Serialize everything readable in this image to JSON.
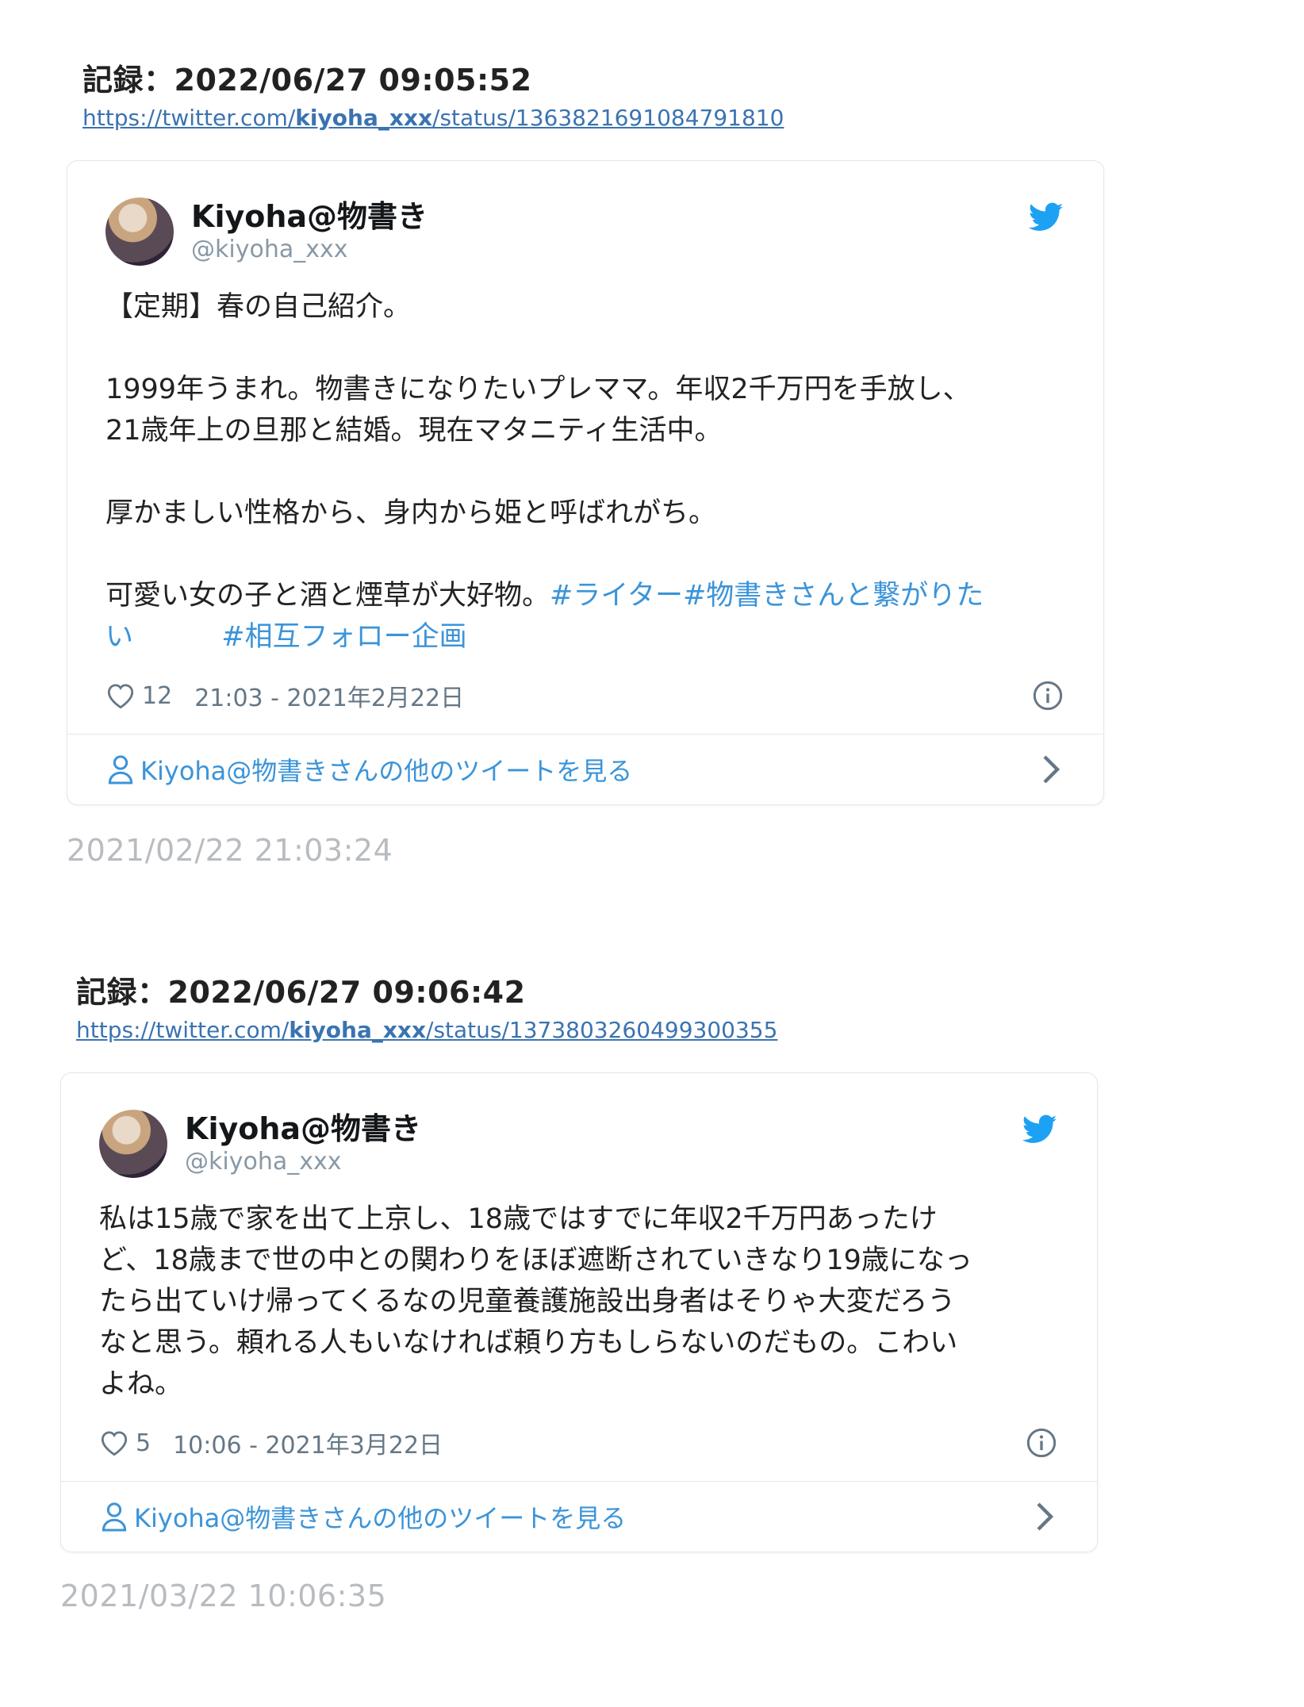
{
  "records": [
    {
      "title": "記録：2022/06/27 09:05:52",
      "url_pre": "https://twitter.com/",
      "url_bold": "kiyoha_xxx",
      "url_post": "/status/1363821691084791810",
      "tweet": {
        "name": "Kiyoha@物書き",
        "handle": "@kiyoha_xxx",
        "line1": "【定期】春の自己紹介。",
        "line2": "1999年うまれ。物書きになりたいプレママ。年収2千万円を手放し、\n21歳年上の旦那と結婚。現在マタニティ生活中。",
        "line3": "厚かましい性格から、身内から姫と呼ばれがち。",
        "line4_text": "可愛い女の子と酒と煙草が大好物。",
        "tag1": "#ライター",
        "tag2": "#物書きさんと繋がりた\nい",
        "tag3": "#相互フォロー企画",
        "likes": "12",
        "time": "21:03 - 2021年2月22日",
        "more": "Kiyoha@物書きさんの他のツイートを見る"
      },
      "stamp": "2021/02/22 21:03:24"
    },
    {
      "title": "記録：2022/06/27 09:06:42",
      "url_pre": "https://twitter.com/",
      "url_bold": "kiyoha_xxx",
      "url_post": "/status/1373803260499300355",
      "tweet": {
        "name": "Kiyoha@物書き",
        "handle": "@kiyoha_xxx",
        "text": "私は15歳で家を出て上京し、18歳ではすでに年収2千万円あったけ\nど、18歳まで世の中との関わりをほぼ遮断されていきなり19歳になっ\nたら出ていけ帰ってくるなの児童養護施設出身者はそりゃ大変だろう\nなと思う。頼れる人もいなければ頼り方もしらないのだもの。こわい\nよね。",
        "likes": "5",
        "time": "10:06 - 2021年3月22日",
        "more": "Kiyoha@物書きさんの他のツイートを見る"
      },
      "stamp": "2021/03/22 10:06:35"
    }
  ],
  "colors": {
    "link": "#3b73b0",
    "tag": "#3b94d9",
    "twitter_blue": "#1da1f2",
    "muted": "#657786",
    "stamp": "#b8bcc0"
  },
  "icons": [
    "twitter-bird-icon",
    "heart-icon",
    "info-icon",
    "person-icon",
    "chevron-right-icon"
  ]
}
